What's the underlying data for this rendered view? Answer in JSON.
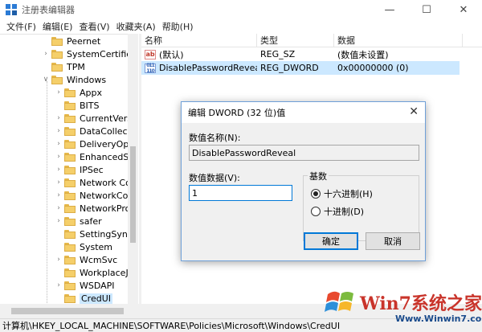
{
  "window": {
    "title": "注册表编辑器"
  },
  "menu": [
    "文件(F)",
    "编辑(E)",
    "查看(V)",
    "收藏夹(A)",
    "帮助(H)"
  ],
  "tree": {
    "items": [
      {
        "label": "Peernet",
        "expandable": false
      },
      {
        "label": "SystemCertificate",
        "expandable": true
      },
      {
        "label": "TPM",
        "expandable": false
      },
      {
        "label": "Windows",
        "expandable": true,
        "expanded": true
      },
      {
        "label": "Appx",
        "expandable": true
      },
      {
        "label": "BITS",
        "expandable": false
      },
      {
        "label": "CurrentVersic",
        "expandable": true
      },
      {
        "label": "DataCollection",
        "expandable": true
      },
      {
        "label": "DeliveryOptin",
        "expandable": true
      },
      {
        "label": "EnhancedStor",
        "expandable": true
      },
      {
        "label": "IPSec",
        "expandable": true
      },
      {
        "label": "Network Con",
        "expandable": true
      },
      {
        "label": "NetworkConn",
        "expandable": true
      },
      {
        "label": "NetworkProv",
        "expandable": true
      },
      {
        "label": "safer",
        "expandable": true
      },
      {
        "label": "SettingSync",
        "expandable": false
      },
      {
        "label": "System",
        "expandable": false
      },
      {
        "label": "WcmSvc",
        "expandable": true
      },
      {
        "label": "WorkplaceJo",
        "expandable": false
      },
      {
        "label": "WSDAPI",
        "expandable": true
      },
      {
        "label": "CredUI",
        "expandable": false,
        "selected": true
      }
    ]
  },
  "list": {
    "columns": [
      "名称",
      "类型",
      "数据"
    ],
    "rows": [
      {
        "icon": "string-value-icon",
        "name": "(默认)",
        "type": "REG_SZ",
        "data": "(数值未设置)"
      },
      {
        "icon": "binary-value-icon",
        "name": "DisablePasswordReveal",
        "type": "REG_DWORD",
        "data": "0x00000000 (0)"
      }
    ]
  },
  "dialog": {
    "title": "编辑 DWORD (32 位)值",
    "close": "✕",
    "name_label": "数值名称(N):",
    "name_value": "DisablePasswordReveal",
    "data_label": "数值数据(V):",
    "data_value": "1",
    "base_label": "基数",
    "radio_hex": "十六进制(H)",
    "radio_dec": "十进制(D)",
    "base_selected": "hex",
    "ok": "确定",
    "cancel": "取消"
  },
  "status": {
    "path": "计算机\\HKEY_LOCAL_MACHINE\\SOFTWARE\\Policies\\Microsoft\\Windows\\CredUI"
  },
  "watermark": {
    "text": "Win7系统之家",
    "url": "Www.Winwin7.com"
  }
}
